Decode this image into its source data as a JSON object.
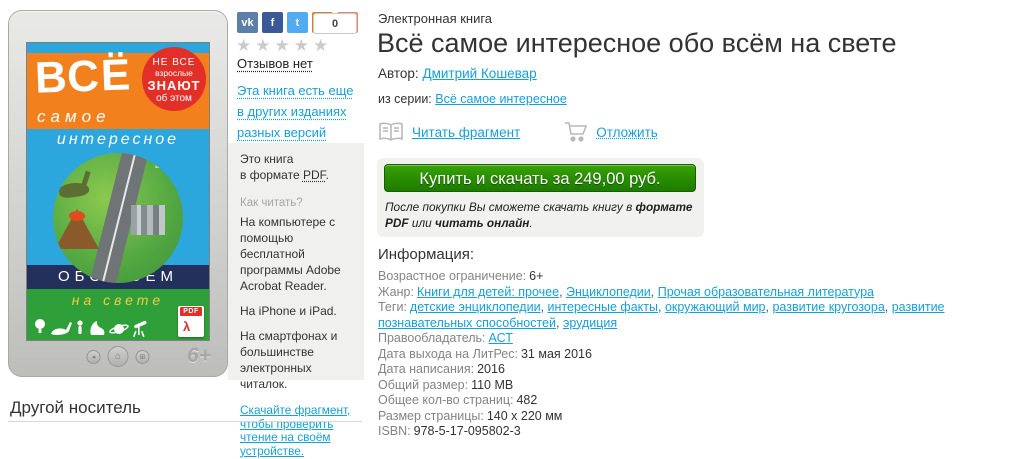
{
  "device": {
    "age_mark": "6+",
    "back_button_glyph": "◂",
    "home_button_glyph": "⌂",
    "apps_button_glyph": "⊞"
  },
  "cover": {
    "word_vse": "ВСЁ",
    "word_samoe": "самое",
    "word_interesnoe": "интересное",
    "badge_lines": [
      "НЕ ВСЕ",
      "взрослые",
      "ЗНАЮТ",
      "об этом"
    ],
    "word_obo_vsem": "ОБО ВСЁМ",
    "word_na_svete": "на свете",
    "pdf_label": "PDF"
  },
  "social": {
    "counter": "0",
    "buttons": [
      {
        "name": "vk",
        "glyph": "vk",
        "color": "#5b7fa6"
      },
      {
        "name": "facebook",
        "glyph": "f",
        "color": "#3b5998"
      },
      {
        "name": "twitter",
        "glyph": "t",
        "color": "#50abf1"
      },
      {
        "name": "odnoklassniki",
        "glyph": "ok",
        "color": "#e17f26"
      },
      {
        "name": "google-plus",
        "glyph": "+",
        "color": "#f4836e"
      }
    ]
  },
  "rating": {
    "stars": "★★★★★",
    "reviews_text": "Отзывов нет"
  },
  "sidebar": {
    "other_editions_link": "Эта книга есть еще в других изданиях разных версий",
    "format_line1": "Это книга",
    "format_prefix": "в формате ",
    "format_link": "PDF",
    "format_period": ".",
    "how_to_read": "Как читать?",
    "read_computer": "На компьютере с помощью бесплатной программы Adobe Acrobat Reader.",
    "read_iphone": "На iPhone и iPad.",
    "read_smart": "На смартфонах и большинстве электронных читалок.",
    "download_fragment_link": "Скачайте фрагмент, чтобы проверить чтение на своём устройстве.",
    "other_media_heading": "Другой носитель"
  },
  "main": {
    "product_kind": "Электронная книга",
    "title": "Всё самое интересное обо всём на свете",
    "author_label": "Автор:",
    "author_link": "Дмитрий Кошевар",
    "series_label": "из серии:",
    "series_link": "Всё самое интересное",
    "read_fragment_label": "Читать фрагмент",
    "postpone_label": "Отложить",
    "buy_button_label": "Купить и скачать за 249,00 руб.",
    "purchase_note": {
      "part1": "После покупки Вы сможете скачать книгу в ",
      "bold1": "формате PDF",
      "part2": " или ",
      "bold2": "читать онлайн",
      "part3": "."
    },
    "info_heading": "Информация:",
    "info_rows": [
      {
        "label": "Возрастное ограничение:",
        "text": "6+"
      },
      {
        "label": "Жанр:",
        "links": [
          "Книги для детей: прочее",
          "Энциклопедии",
          "Прочая образовательная литература"
        ]
      },
      {
        "label": "Теги:",
        "links": [
          "детские энциклопедии",
          "интересные факты",
          "окружающий мир",
          "развитие кругозора",
          "развитие познавательных способностей",
          "эрудиция"
        ]
      },
      {
        "label": "Правообладатель:",
        "links": [
          "АСТ"
        ]
      },
      {
        "label": "Дата выхода на ЛитРес:",
        "text": "31 мая 2016"
      },
      {
        "label": "Дата написания:",
        "text": "2016"
      },
      {
        "label": "Общий размер:",
        "text": "110 MB"
      },
      {
        "label": "Общее кол-во страниц:",
        "text": "482"
      },
      {
        "label": "Размер страницы:",
        "text": "140 x 220 мм"
      },
      {
        "label": "ISBN:",
        "text": "978-5-17-095802-3"
      }
    ]
  },
  "colors": {
    "link_blue": "#14a0d9",
    "buy_green_top": "#3aa302",
    "buy_green_bottom": "#1d7c00",
    "cover_orange": "#f2801d",
    "cover_blue": "#2ba7de",
    "cover_red": "#e23028",
    "cover_navy": "#24305c",
    "cover_green": "#2fa039",
    "stars_gray": "#cbcbcb"
  }
}
